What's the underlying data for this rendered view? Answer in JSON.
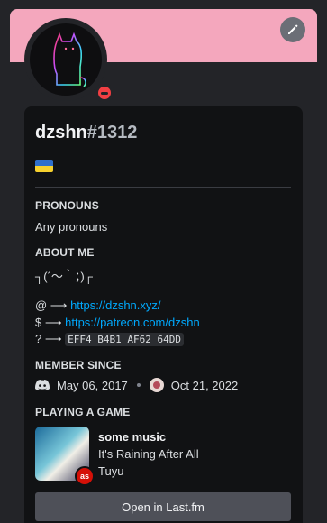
{
  "profile": {
    "username": "dzshn",
    "discriminator": "#1312",
    "status": "do-not-disturb",
    "flag": "ukraine-flag"
  },
  "pronouns": {
    "title": "PRONOUNS",
    "value": "Any pronouns"
  },
  "about": {
    "title": "ABOUT ME",
    "kaomoji": "┐(´〜｀；)┌",
    "lines": [
      {
        "prefix": "@ ⟶",
        "link": "https://dzshn.xyz/"
      },
      {
        "prefix": "$ ⟶",
        "link": "https://patreon.com/dzshn"
      },
      {
        "prefix": "? ⟶",
        "code": "EFF4 B4B1 AF62 64DD"
      }
    ]
  },
  "member_since": {
    "title": "MEMBER SINCE",
    "discord_date": "May 06, 2017",
    "server_date": "Oct 21, 2022"
  },
  "activity": {
    "title": "PLAYING A GAME",
    "name": "some music",
    "track": "It's Raining After All",
    "artist": "Tuyu",
    "badge": "lastfm-icon",
    "badge_text": "as",
    "button_label": "Open in Last.fm"
  },
  "colors": {
    "banner": "#f4a7bd",
    "link": "#00a8fc",
    "status": "#f23f43"
  }
}
